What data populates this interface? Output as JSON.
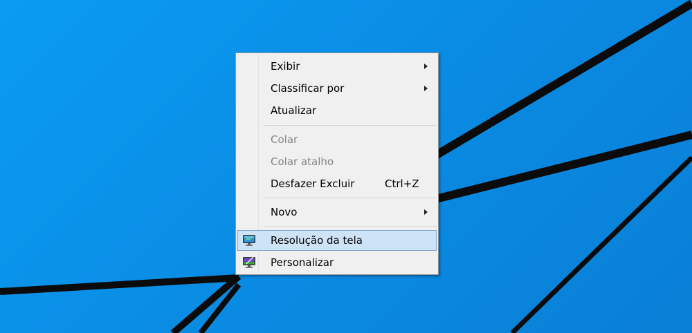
{
  "desktop": {
    "background_color": "#0b8fe8",
    "line_color": "#0b0b0b"
  },
  "context_menu": {
    "items": [
      {
        "label": "Exibir",
        "has_submenu": true,
        "enabled": true
      },
      {
        "label": "Classificar por",
        "has_submenu": true,
        "enabled": true
      },
      {
        "label": "Atualizar",
        "has_submenu": false,
        "enabled": true
      },
      {
        "label": "Colar",
        "has_submenu": false,
        "enabled": false
      },
      {
        "label": "Colar atalho",
        "has_submenu": false,
        "enabled": false
      },
      {
        "label": "Desfazer Excluir",
        "shortcut": "Ctrl+Z",
        "has_submenu": false,
        "enabled": true
      },
      {
        "label": "Novo",
        "has_submenu": true,
        "enabled": true
      },
      {
        "label": "Resolução da tela",
        "icon": "display-resolution-icon",
        "has_submenu": false,
        "enabled": true,
        "highlighted": true
      },
      {
        "label": "Personalizar",
        "icon": "personalize-icon",
        "has_submenu": false,
        "enabled": true
      }
    ],
    "highlight_color": "#cfe3f7",
    "highlight_border_color": "#7da2ce",
    "disabled_text_color": "#838383"
  }
}
